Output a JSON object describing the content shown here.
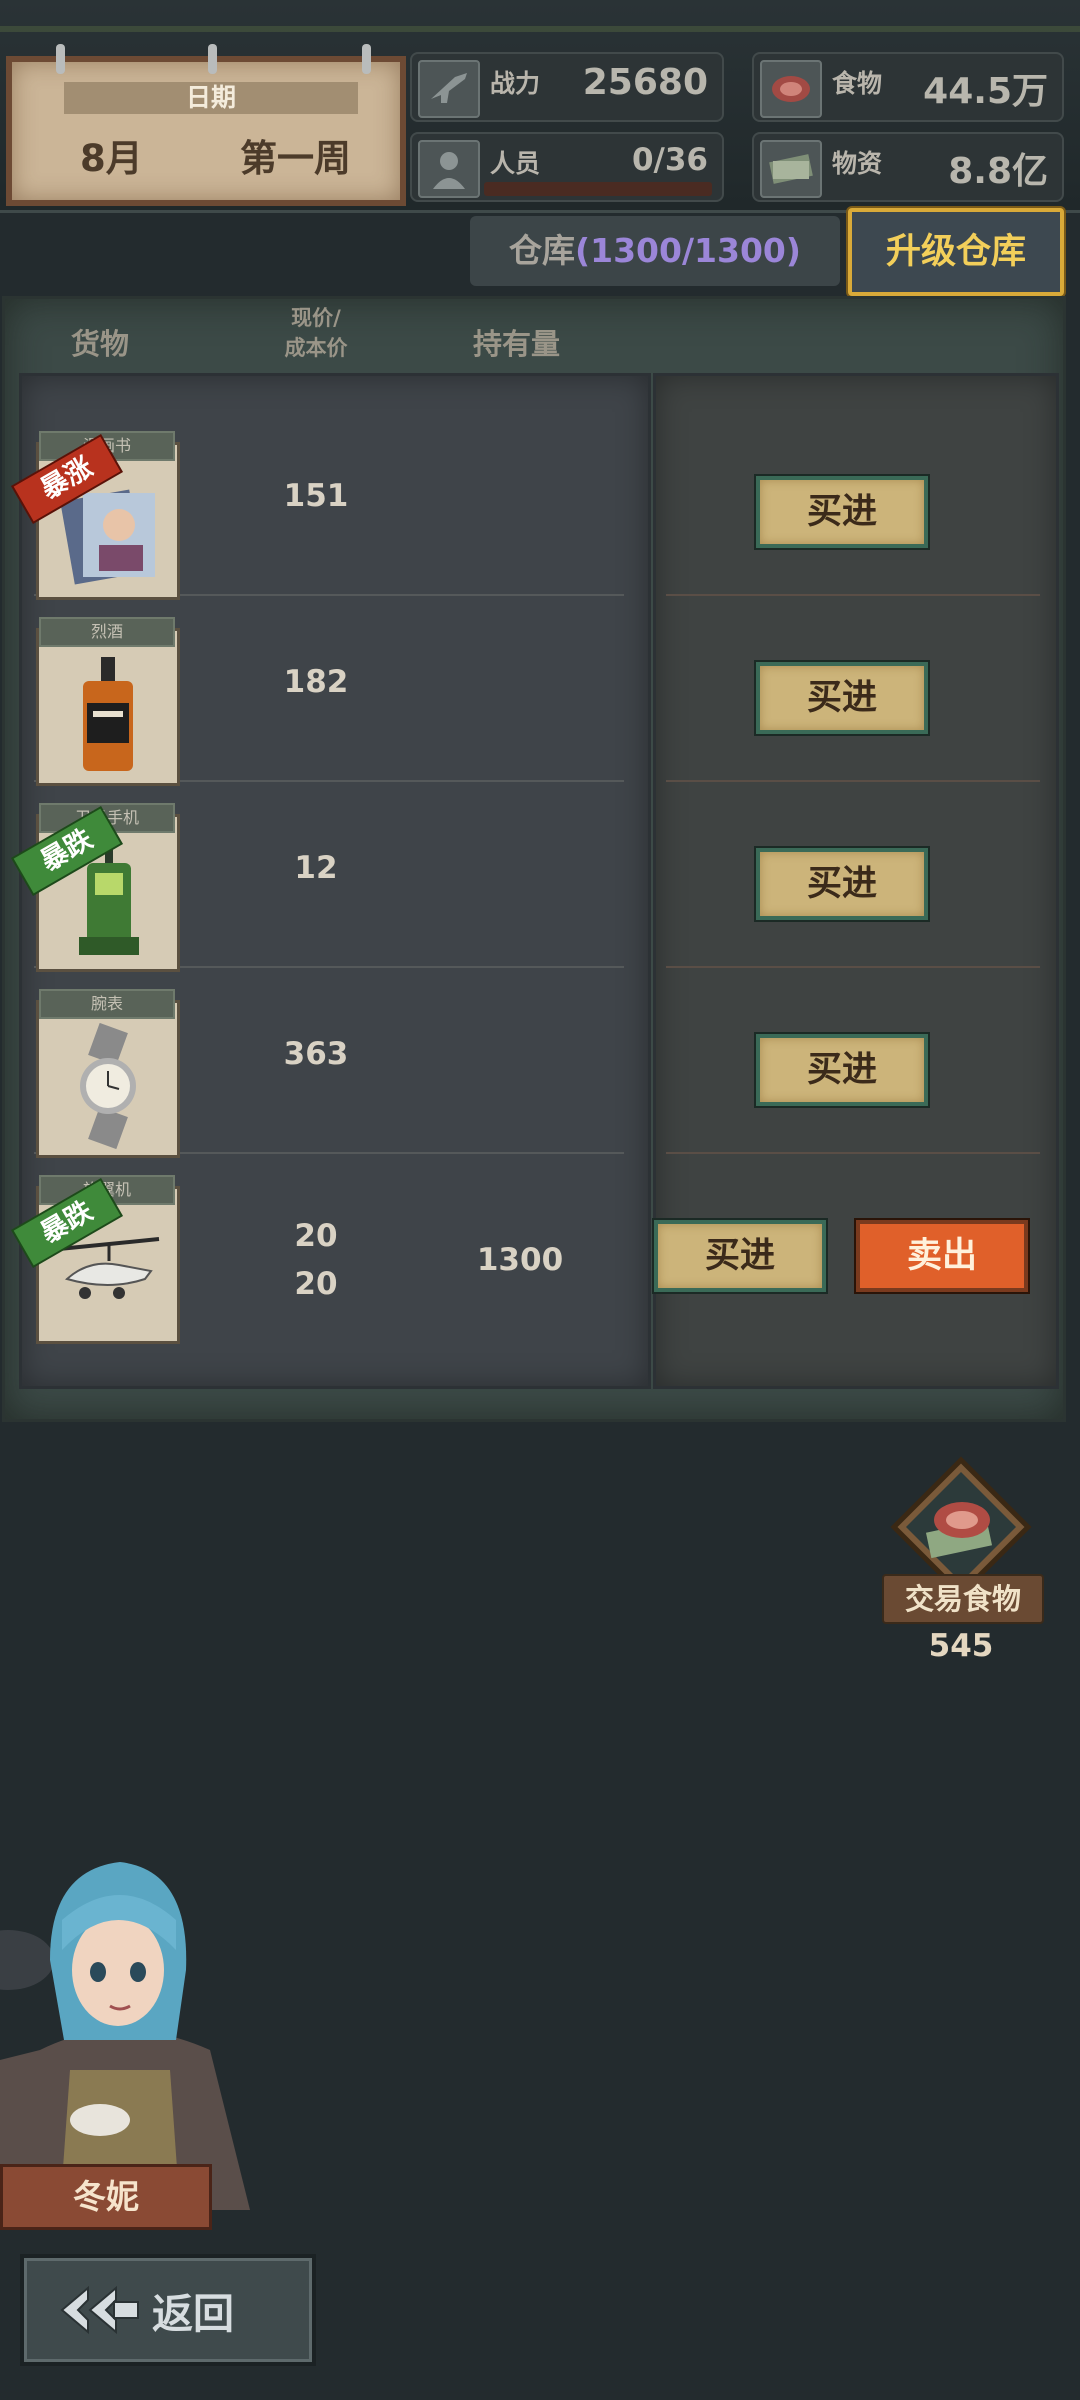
{
  "header": {
    "date_title": "日期",
    "month": "8月",
    "week": "第一周",
    "power_label": "战力",
    "power_value": "25680",
    "staff_label": "人员",
    "staff_value": "0/36",
    "food_label": "食物",
    "food_value": "44.5万",
    "supplies_label": "物资",
    "supplies_value": "8.8亿"
  },
  "warehouse": {
    "label": "仓库",
    "open_paren": "(",
    "count": "1300/1300",
    "close_paren": ")",
    "upgrade_label": "升级仓库"
  },
  "table": {
    "col_goods": "货物",
    "col_price_line1": "现价/",
    "col_price_line2": "成本价",
    "col_holding": "持有量"
  },
  "items": [
    {
      "tag": "漫画书",
      "badge": "暴涨",
      "badge_type": "up",
      "price": "151",
      "cost": "",
      "holding": "",
      "buy_label": "买进",
      "sell_label": ""
    },
    {
      "tag": "烈酒",
      "badge": "",
      "badge_type": "",
      "price": "182",
      "cost": "",
      "holding": "",
      "buy_label": "买进",
      "sell_label": ""
    },
    {
      "tag": "卫星手机",
      "badge": "暴跌",
      "badge_type": "down",
      "price": "12",
      "cost": "",
      "holding": "",
      "buy_label": "买进",
      "sell_label": ""
    },
    {
      "tag": "腕表",
      "badge": "",
      "badge_type": "",
      "price": "363",
      "cost": "",
      "holding": "",
      "buy_label": "买进",
      "sell_label": ""
    },
    {
      "tag": "旋翼机",
      "badge": "暴跌",
      "badge_type": "down",
      "price": "20",
      "cost": "20",
      "holding": "1300",
      "buy_label": "买进",
      "sell_label": "卖出"
    }
  ],
  "trade": {
    "label": "交易食物",
    "count": "545"
  },
  "character": {
    "name": "冬妮"
  },
  "nav": {
    "back_label": "返回"
  },
  "colors": {
    "background": "#232b2e",
    "accent_gold": "#f3cf5a",
    "sell_orange": "#e0602a",
    "warehouse_count": "#9b86d8"
  }
}
